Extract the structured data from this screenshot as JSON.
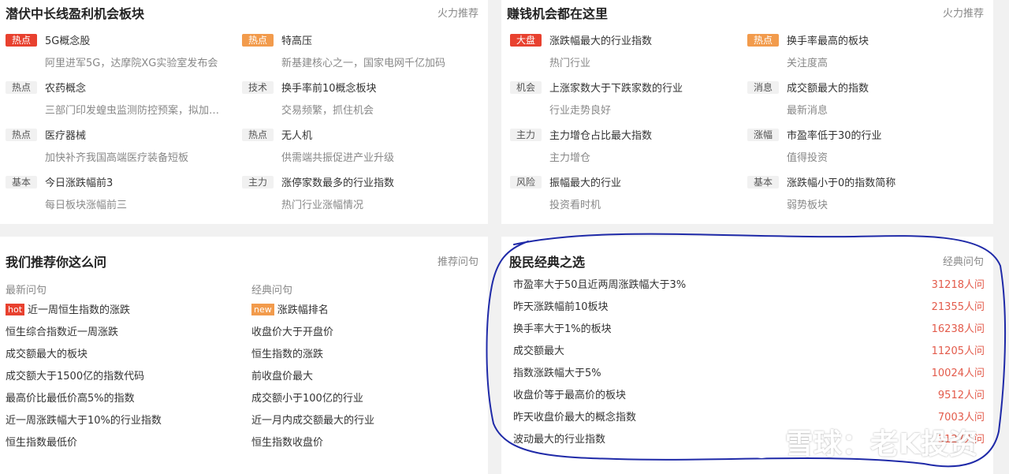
{
  "p1": {
    "title": "潜伏中长线盈利机会板块",
    "more": "火力推荐",
    "items": [
      {
        "tag": "热点",
        "title": "5G概念股",
        "sub": "阿里进军5G，达摩院XG实验室发布会"
      },
      {
        "tag": "热点",
        "title": "特高压",
        "sub": "新基建核心之一，国家电网千亿加码"
      },
      {
        "tag": "热点",
        "title": "农药概念",
        "sub": "三部门印发蝗虫监测防控预案，拟加强防控"
      },
      {
        "tag": "技术",
        "title": "换手率前10概念板块",
        "sub": "交易频繁，抓住机会"
      },
      {
        "tag": "热点",
        "title": "医疗器械",
        "sub": "加快补齐我国高端医疗装备短板"
      },
      {
        "tag": "热点",
        "title": "无人机",
        "sub": "供需端共振促进产业升级"
      },
      {
        "tag": "基本",
        "title": "今日涨跌幅前3",
        "sub": "每日板块涨幅前三"
      },
      {
        "tag": "主力",
        "title": "涨停家数最多的行业指数",
        "sub": "热门行业涨幅情况"
      }
    ]
  },
  "p2": {
    "title": "赚钱机会都在这里",
    "more": "火力推荐",
    "items": [
      {
        "tag": "大盘",
        "title": "涨跌幅最大的行业指数",
        "sub": "热门行业"
      },
      {
        "tag": "热点",
        "title": "换手率最高的板块",
        "sub": "关注度高"
      },
      {
        "tag": "机会",
        "title": "上涨家数大于下跌家数的行业",
        "sub": "行业走势良好"
      },
      {
        "tag": "消息",
        "title": "成交额最大的指数",
        "sub": "最新消息"
      },
      {
        "tag": "主力",
        "title": "主力增仓占比最大指数",
        "sub": "主力增仓"
      },
      {
        "tag": "涨幅",
        "title": "市盈率低于30的行业",
        "sub": "值得投资"
      },
      {
        "tag": "风险",
        "title": "振幅最大的行业",
        "sub": "投资看时机"
      },
      {
        "tag": "基本",
        "title": "涨跌幅小于0的指数简称",
        "sub": "弱势板块"
      }
    ]
  },
  "p3": {
    "title": "我们推荐你这么问",
    "more": "推荐问句",
    "col1_head": "最新问句",
    "col2_head": "经典问句",
    "hot_badge": "hot",
    "new_badge": "new",
    "col1": [
      "近一周恒生指数的涨跌",
      "恒生综合指数近一周涨跌",
      "成交额最大的板块",
      "成交额大于1500亿的指数代码",
      "最高价比最低价高5%的指数",
      "近一周涨跌幅大于10%的行业指数",
      "恒生指数最低价"
    ],
    "col2": [
      "涨跌幅排名",
      "收盘价大于开盘价",
      "恒生指数的涨跌",
      "前收盘价最大",
      "成交额小于100亿的行业",
      "近一月内成交额最大的行业",
      "恒生指数收盘价"
    ]
  },
  "p4": {
    "title": "股民经典之选",
    "more": "经典问句",
    "rows": [
      {
        "q": "市盈率大于50且近两周涨跌幅大于3%",
        "c": "31218人问"
      },
      {
        "q": "昨天涨跌幅前10板块",
        "c": "21355人问"
      },
      {
        "q": "换手率大于1%的板块",
        "c": "16238人问"
      },
      {
        "q": "成交额最大",
        "c": "11205人问"
      },
      {
        "q": "指数涨跌幅大于5%",
        "c": "10024人问"
      },
      {
        "q": "收盘价等于最高价的板块",
        "c": "9512人问"
      },
      {
        "q": "昨天收盘价最大的概念指数",
        "c": "7003人问"
      },
      {
        "q": "波动最大的行业指数",
        "c": "3127人问"
      }
    ]
  },
  "watermark": "雪球：老K投资",
  "colors": {
    "tag_red": "#e8412f",
    "tag_orange": "#f29b4c",
    "count_red": "#e35b4b",
    "circle": "#1f2aa8"
  }
}
